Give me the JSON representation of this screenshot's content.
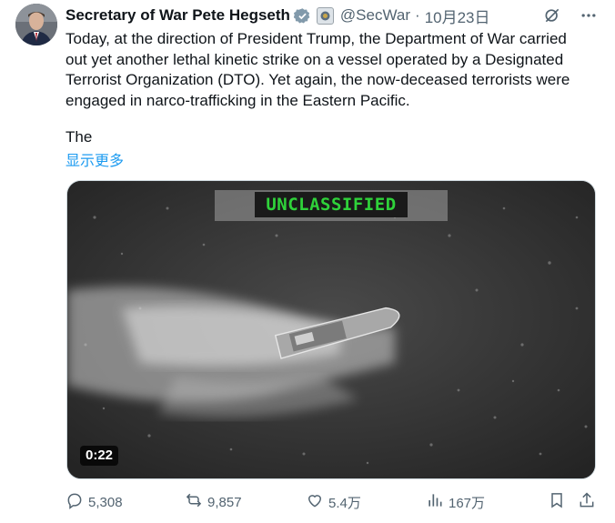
{
  "tweet": {
    "author_name": "Secretary of War Pete Hegseth",
    "handle": "@SecWar",
    "separator": "·",
    "date": "10月23日",
    "text_lines": [
      "Today, at the direction of President Trump, the Department of War carried",
      "out yet another lethal kinetic strike on a vessel operated by a Designated",
      "Terrorist Organization (DTO). Yet again, the now-deceased terrorists were",
      "engaged in narco-trafficking in the Eastern Pacific."
    ],
    "text_tail": "The",
    "show_more": "显示更多"
  },
  "media": {
    "classification": "UNCLASSIFIED",
    "duration": "0:22"
  },
  "actions": {
    "replies": "5,308",
    "reposts": "9,857",
    "likes": "5.4万",
    "views": "167万"
  },
  "colors": {
    "accent": "#1d9bf0",
    "secondary_text": "#536471",
    "classification_green": "#2fd23a"
  },
  "icons": {
    "verified": "verified-badge-icon",
    "org": "affiliate-badge-icon",
    "grok": "grok-icon",
    "more": "more-icon",
    "reply": "reply-icon",
    "repost": "repost-icon",
    "like": "like-icon",
    "views": "views-icon",
    "bookmark": "bookmark-icon",
    "share": "share-icon"
  }
}
